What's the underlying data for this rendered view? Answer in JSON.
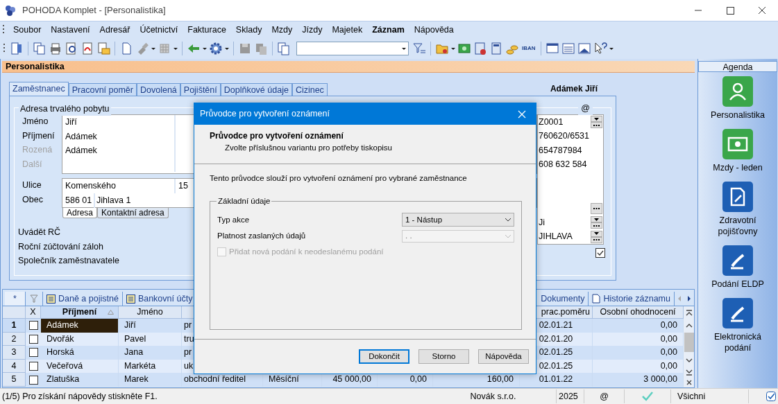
{
  "window": {
    "title": "POHODA Komplet - [Personalistika]"
  },
  "menu": [
    {
      "label": "Soubor",
      "bold": false
    },
    {
      "label": "Nastavení",
      "bold": false
    },
    {
      "label": "Adresář",
      "bold": false
    },
    {
      "label": "Účetnictví",
      "bold": false
    },
    {
      "label": "Fakturace",
      "bold": false
    },
    {
      "label": "Sklady",
      "bold": false
    },
    {
      "label": "Mzdy",
      "bold": false
    },
    {
      "label": "Jízdy",
      "bold": false
    },
    {
      "label": "Majetek",
      "bold": false
    },
    {
      "label": "Záznam",
      "bold": true
    },
    {
      "label": "Nápověda",
      "bold": false
    }
  ],
  "toolbar": {
    "iban_label": "IBAN"
  },
  "agenda_title": "Personalistika",
  "form_tabs": [
    {
      "label": "Zaměstnanec",
      "selected": true
    },
    {
      "label": "Pracovní poměr",
      "selected": false
    },
    {
      "label": "Dovolená",
      "selected": false
    },
    {
      "label": "Pojištění",
      "selected": false
    },
    {
      "label": "Doplňkové údaje",
      "selected": false
    },
    {
      "label": "Cizinec",
      "selected": false
    }
  ],
  "employee_name": "Adámek Jiří",
  "address_group": {
    "title": "Adresa trvalého pobytu",
    "name_fields": [
      {
        "label": "Jméno",
        "value": "Jiří",
        "disabled": false
      },
      {
        "label": "Příjmení",
        "value": "Adámek",
        "disabled": false
      },
      {
        "label": "Rozená",
        "value": "Adámek",
        "disabled": true
      },
      {
        "label": "Další",
        "disabled": true
      }
    ],
    "street": {
      "label": "Ulice",
      "value": "Komenského",
      "number": "15"
    },
    "city": {
      "label": "Obec",
      "zip": "586 01",
      "value": "Jihlava 1"
    },
    "address_tabs": [
      {
        "label": "Adresa",
        "selected": true
      },
      {
        "label": "Kontaktní adresa",
        "selected": false
      }
    ],
    "options": [
      "Uvádět RČ",
      "Roční zúčtování záloh",
      "Společník zaměstnavatele"
    ]
  },
  "contact_group": {
    "title": "@",
    "top_fields": [
      {
        "kind": "combo",
        "value": "Z0001"
      },
      {
        "kind": "text",
        "value": "760620/6531"
      },
      {
        "kind": "text",
        "value": "654787984"
      },
      {
        "kind": "text",
        "value": "608 632 584"
      }
    ],
    "bottom_fields": [
      {
        "kind": "button"
      },
      {
        "kind": "combo",
        "value": "Ji"
      },
      {
        "kind": "combo",
        "value": "JIHLAVA"
      }
    ],
    "checked": true
  },
  "table_tabs": [
    {
      "kind": "new",
      "label": "*",
      "selected": true
    },
    {
      "kind": "filter",
      "selected": false
    },
    {
      "kind": "list",
      "label": "Daně a pojistné",
      "selected": false
    },
    {
      "kind": "list",
      "label": "Bankovní účty",
      "selected": false
    }
  ],
  "table_tabs_right": [
    {
      "kind": "text",
      "label": "Dokumenty",
      "selected": false
    },
    {
      "kind": "doc",
      "label": "Historie záznamu",
      "selected": false
    }
  ],
  "table": {
    "check_header": "X",
    "columns": [
      {
        "label": "Příjmení",
        "sorted": true
      },
      {
        "label": "Jméno",
        "sorted": false
      },
      null,
      null,
      null,
      null,
      null,
      {
        "label": "prac.poměru",
        "sorted": false
      },
      {
        "label": "Osobní ohodnocení",
        "sorted": false
      }
    ],
    "rows": [
      {
        "index": "1",
        "selected": true,
        "checked": false,
        "cells": [
          "Adámek",
          "Jiří",
          "pr",
          null,
          null,
          null,
          null,
          "02.01.21",
          "0,00"
        ]
      },
      {
        "index": "2",
        "selected": false,
        "checked": false,
        "cells": [
          "Dvořák",
          "Pavel",
          "tru",
          null,
          null,
          null,
          null,
          "02.01.20",
          "0,00"
        ]
      },
      {
        "index": "3",
        "selected": false,
        "checked": false,
        "cells": [
          "Horská",
          "Jana",
          "pr",
          null,
          null,
          null,
          null,
          "02.01.25",
          "0,00"
        ]
      },
      {
        "index": "4",
        "selected": false,
        "checked": false,
        "cells": [
          "Večeřová",
          "Markéta",
          "uk",
          null,
          null,
          null,
          null,
          "02.01.25",
          "0,00"
        ]
      },
      {
        "index": "5",
        "selected": false,
        "checked": false,
        "cells": [
          "Zlatuška",
          "Marek",
          "obchodní ředitel",
          "Měsíční",
          "45 000,00",
          "0,00",
          "160,00",
          "01.01.22",
          "3 000,00"
        ]
      }
    ]
  },
  "agenda": {
    "title": "Agenda",
    "items": [
      {
        "kind": "person",
        "label": "Personalistika"
      },
      {
        "kind": "money",
        "label": "Mzdy - leden"
      },
      {
        "kind": "document",
        "label": "Zdravotní pojišťovny"
      },
      {
        "kind": "pen",
        "label": "Podání ELDP"
      },
      {
        "kind": "pen",
        "label": "Elektronická podání"
      }
    ]
  },
  "status_bar": {
    "help": "(1/5) Pro získání nápovědy stiskněte F1.",
    "company": "Novák s.r.o.",
    "year": "2025",
    "email": "@",
    "user_filter": "Všichni"
  },
  "dialog": {
    "title": "Průvodce pro vytvoření oznámení",
    "heading": "Průvodce pro vytvoření oznámení",
    "subheading": "Zvolte příslušnou variantu pro potřeby tiskopisu",
    "intro": "Tento průvodce slouží pro vytvoření oznámení pro vybrané zaměstnance",
    "group": {
      "title": "Základní údaje",
      "fields": [
        {
          "label": "Typ akce",
          "value": "1 - Nástup",
          "disabled": false
        },
        {
          "label": "Platnost zaslaných údajů",
          "value": ". .",
          "disabled": true
        }
      ],
      "checkbox": {
        "label": "Přidat nová podání k neodeslanému podání",
        "checked": false,
        "disabled": true
      }
    },
    "buttons": [
      {
        "label": "Dokončit",
        "default": true
      },
      {
        "label": "Storno",
        "default": false
      },
      {
        "label": "Nápověda",
        "default": false
      }
    ]
  }
}
